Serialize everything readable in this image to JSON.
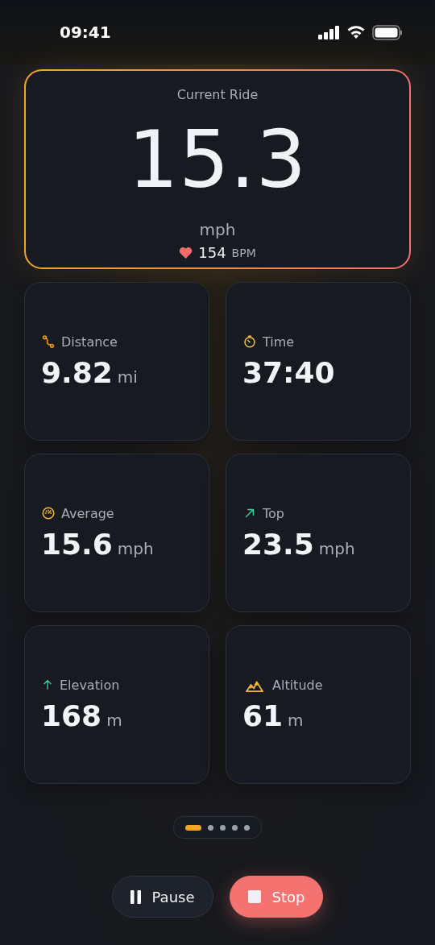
{
  "status_bar": {
    "time": "09:41"
  },
  "hero": {
    "title": "Current Ride",
    "speed": "15.3",
    "unit": "mph",
    "heart_rate": "154",
    "heart_unit": "BPM"
  },
  "metrics": [
    {
      "label": "Distance",
      "value": "9.82",
      "unit": "mi"
    },
    {
      "label": "Time",
      "value": "37:40"
    },
    {
      "label": "Average",
      "value": "15.6",
      "unit": "mph"
    },
    {
      "label": "Top",
      "value": "23.5",
      "unit": "mph"
    },
    {
      "label": "Elevation",
      "value": "168",
      "unit": "m"
    },
    {
      "label": "Altitude",
      "value": "61",
      "unit": "m"
    }
  ],
  "pages": [
    {
      "selected": true
    },
    {
      "selected": false
    },
    {
      "selected": false
    },
    {
      "selected": false
    },
    {
      "selected": false
    }
  ],
  "buttons": [
    {
      "kind": "pause",
      "label": "Pause"
    },
    {
      "kind": "stop",
      "label": "Stop"
    }
  ]
}
